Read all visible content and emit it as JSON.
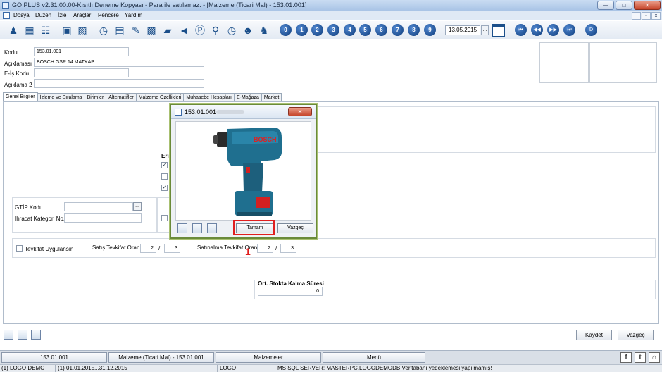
{
  "window": {
    "title": "GO PLUS v2.31.00.00-Kısıtlı Deneme Kopyası - Para ile satılamaz. - [Malzeme (Ticari Mal) - 153.01.001]",
    "min": "—",
    "max": "□",
    "close": "✕"
  },
  "menu": {
    "items": [
      "Dosya",
      "Düzen",
      "İzle",
      "Araçlar",
      "Pencere",
      "Yardım"
    ],
    "mdi_min": "_",
    "mdi_max": "▫",
    "mdi_close": "x"
  },
  "toolbar": {
    "numbers": [
      "0",
      "1",
      "2",
      "3",
      "4",
      "5",
      "6",
      "7",
      "8",
      "9"
    ],
    "date": "13.05.2015",
    "date_button": "...",
    "nav": [
      "⏮",
      "◀◀",
      "▶▶",
      "⏭"
    ],
    "d_button": "D"
  },
  "form": {
    "kodu_label": "Kodu",
    "kodu_value": "153.01.001",
    "aciklama_label": "Açıklaması",
    "aciklama_value": "BOSCH GSR 14 MATKAP",
    "eis_label": "E-İş Kodu",
    "eis_value": "",
    "aciklama2_label": "Açıklama 2",
    "aciklama2_value": ""
  },
  "tabs": [
    "Genel Bilgiler",
    "İzleme ve Sıralama",
    "Birimler",
    "Alternatifler",
    "Malzeme Özellikleri",
    "Muhasebe Hesapları",
    "E-Mağaza",
    "Market"
  ],
  "general": {
    "erisim_label": "Erişi",
    "gtip_label": "GTİP Kodu",
    "gtip_button": "...",
    "ihracat_label": "İhracat Kategori No.",
    "tevkifat_label": "Tevkifat Uygulansın",
    "satis_tevkifat_label": "Satış Tevkifat Oranı",
    "satis_num": "2",
    "satis_den": "3",
    "satinalma_tevkifat_label": "Satınalma Tevkifat Oranı",
    "satinalma_num": "2",
    "satinalma_den": "3",
    "slash": "/",
    "ort_label": "Ort. Stokta Kalma Süresi",
    "ort_value": "0"
  },
  "dialog": {
    "title": "153.01.001",
    "close": "✕",
    "ok_label": "Tamam",
    "cancel_label": "Vazgeç",
    "product_brand": "BOSCH"
  },
  "annotation": {
    "marker": "1"
  },
  "buttons": {
    "save": "Kaydet",
    "cancel": "Vazgeç"
  },
  "taskbar": {
    "items": [
      "153.01.001",
      "Malzeme (Ticari Mal) - 153.01.001",
      "Malzemeler",
      "Menü"
    ],
    "social": [
      "f",
      "t",
      "⌂"
    ]
  },
  "status": {
    "firm": "(1) LOGO DEMO",
    "period": "(1) 01.01.2015...31.12.2015",
    "user": "LOGO",
    "message": "MS SQL SERVER: MASTERPC.LOGODEMODB Veritabanı yedeklemesi yapılmamış!"
  },
  "colors": {
    "accent": "#0d3b7a",
    "highlight": "#e01e1e",
    "dialog_border": "#6a8a3a"
  }
}
